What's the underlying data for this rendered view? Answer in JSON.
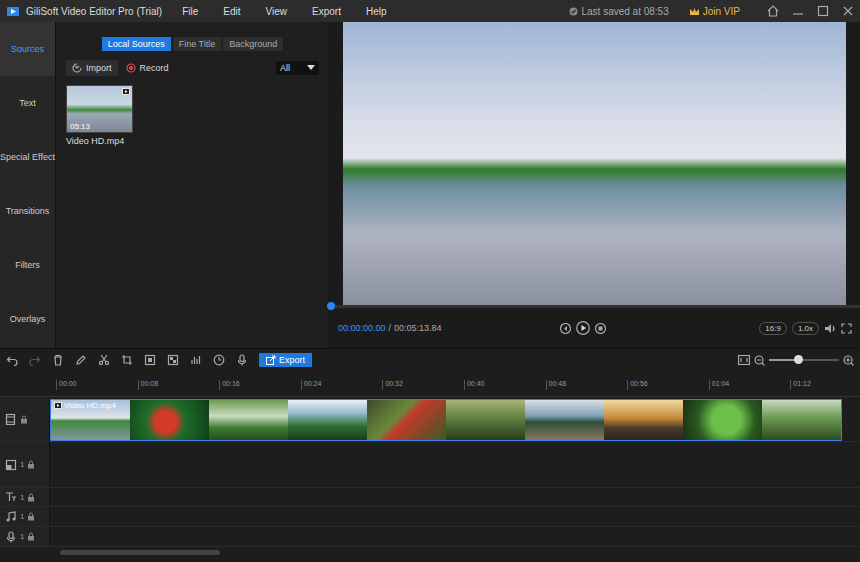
{
  "window": {
    "title": "GiliSoft Video Editor Pro (Trial)",
    "menu": [
      "File",
      "Edit",
      "View",
      "Export",
      "Help"
    ],
    "last_saved": "Last saved at 08:53",
    "vip": "Join VIP"
  },
  "sidebar": {
    "items": [
      {
        "label": "Sources",
        "selected": true
      },
      {
        "label": "Text",
        "selected": false
      },
      {
        "label": "Special Effect",
        "selected": false
      },
      {
        "label": "Transitions",
        "selected": false
      },
      {
        "label": "Filters",
        "selected": false
      },
      {
        "label": "Overlays",
        "selected": false
      }
    ]
  },
  "panel": {
    "tabs": [
      {
        "label": "Local Sources",
        "selected": true
      },
      {
        "label": "Fine Title",
        "selected": false
      },
      {
        "label": "Background",
        "selected": false
      }
    ],
    "import": "Import",
    "record": "Record",
    "filter": "All",
    "media": [
      {
        "name": "Video HD.mp4",
        "duration": "05:13"
      }
    ]
  },
  "preview": {
    "current_time": "00:00:00.00",
    "separator": "/",
    "total_time": "00:05:13.84",
    "progress": 0,
    "aspect": "16:9",
    "speed": "1.0x"
  },
  "toolbar": {
    "export": "Export",
    "zoom": 0.42
  },
  "timeline": {
    "ruler": [
      "00:00",
      "00:08",
      "00:16",
      "00:24",
      "00:32",
      "00:40",
      "00:48",
      "00:56",
      "01:04",
      "01:12"
    ],
    "tracks": [
      {
        "kind": "video",
        "number": "",
        "clip": "Video HD.mp4"
      },
      {
        "kind": "overlay",
        "number": "1",
        "clip": ""
      },
      {
        "kind": "text",
        "number": "1",
        "clip": ""
      },
      {
        "kind": "music",
        "number": "1",
        "clip": ""
      },
      {
        "kind": "voice",
        "number": "1",
        "clip": ""
      }
    ]
  }
}
